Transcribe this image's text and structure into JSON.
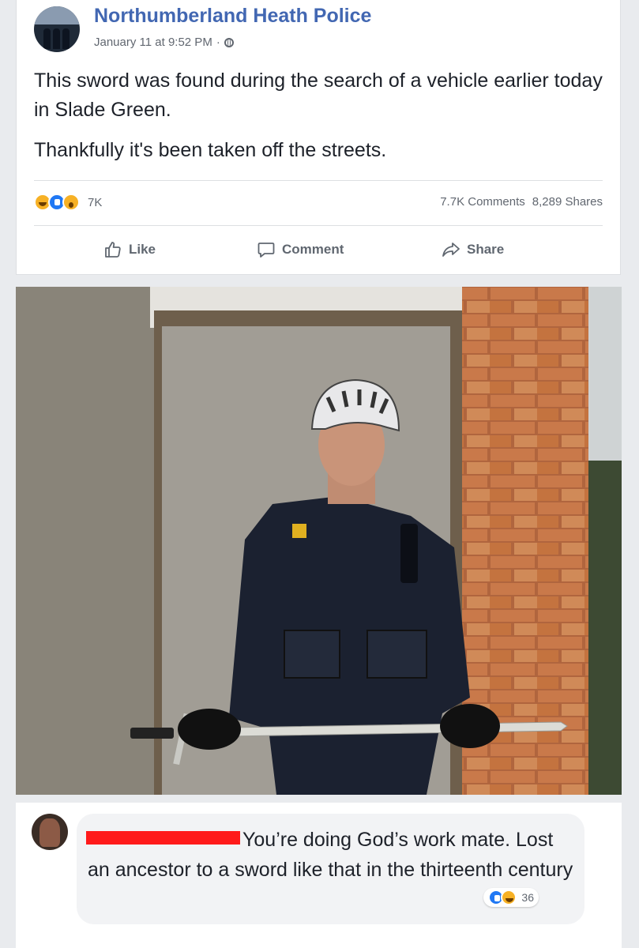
{
  "post": {
    "page_name": "Northumberland Heath Police",
    "timestamp": "January 11 at 9:52 PM",
    "privacy_icon": "globe-icon",
    "text": [
      "This sword was found during the search of a vehicle earlier today in Slade Green.",
      "Thankfully it's been taken off the streets."
    ],
    "reactions": [
      "haha",
      "like",
      "wow"
    ],
    "reaction_count": "7K",
    "comments_count": "7.7K Comments",
    "shares_count": "8,289 Shares"
  },
  "actions": {
    "like": "Like",
    "comment": "Comment",
    "share": "Share"
  },
  "comment": {
    "text": "You’re doing God’s work mate. Lost an ancestor to a sword like that in the thirteenth century",
    "reactions": [
      "like",
      "haha"
    ],
    "reaction_count": "36"
  },
  "colors": {
    "brand": "#4267b2",
    "meta_text": "#616770",
    "redaction": "#ff1a1a"
  }
}
